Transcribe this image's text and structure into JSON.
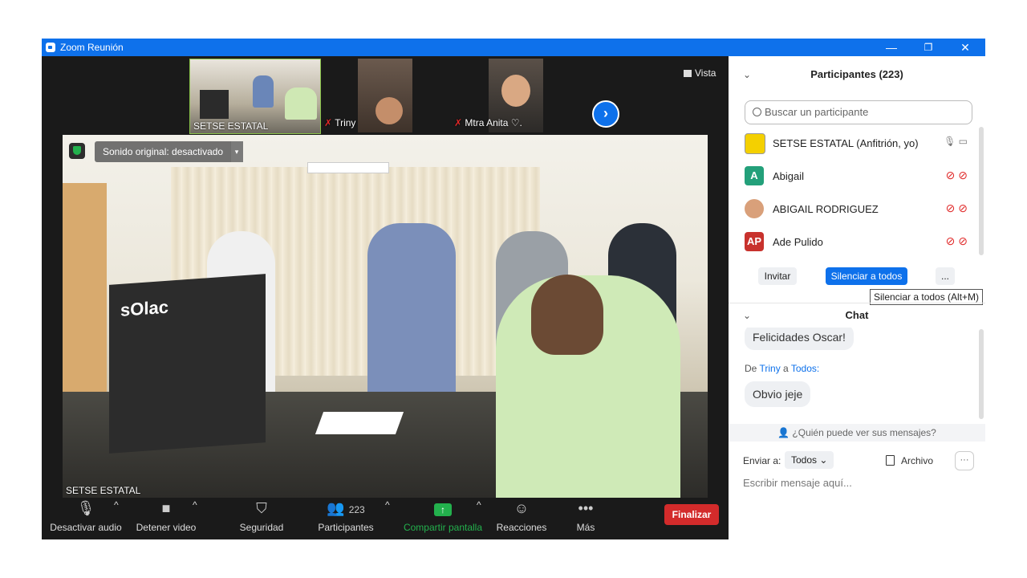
{
  "window": {
    "title": "Zoom Reunión",
    "controls": {
      "minimize": "—",
      "restore": "❐",
      "close": "✕"
    }
  },
  "gallery": {
    "thumbnails": [
      {
        "name": "SETSE ESTATAL",
        "muted": false
      },
      {
        "name": "Triny",
        "muted": true
      },
      {
        "name": "Mtra Anita ♡.",
        "muted": true
      }
    ],
    "next_arrow": "›",
    "view_label": "Vista"
  },
  "main_video": {
    "sound_label": "Sonido original: desactivado",
    "sound_dropdown": "▾",
    "box_brand": "sOlac",
    "speaker_name": "SETSE ESTATAL"
  },
  "toolbar": {
    "audio": "Desactivar audio",
    "video": "Detener video",
    "security": "Seguridad",
    "participants": "Participantes",
    "participants_count": "223",
    "share": "Compartir pantalla",
    "reactions": "Reacciones",
    "more": "Más",
    "end": "Finalizar",
    "caret": "^",
    "more_dots": "•••"
  },
  "participants_panel": {
    "title": "Participantes (223)",
    "collapse": "⌄",
    "search_placeholder": "Buscar un participante",
    "list": [
      {
        "name": "SETSE ESTATAL (Anfitrión, yo)",
        "avatar": "",
        "avatar_color": "#f4d000",
        "status": "host"
      },
      {
        "name": "Abigail",
        "avatar": "A",
        "avatar_color": "#23a07a",
        "status": "muted"
      },
      {
        "name": "ABIGAIL RODRIGUEZ",
        "avatar": "",
        "avatar_color": "#d9a07a",
        "status": "muted"
      },
      {
        "name": "Ade Pulido",
        "avatar": "AP",
        "avatar_color": "#c8322d",
        "status": "muted"
      }
    ],
    "invite": "Invitar",
    "mute_all": "Silenciar a todos",
    "more": "...",
    "tooltip": "Silenciar a todos (Alt+M)"
  },
  "chat": {
    "title": "Chat",
    "collapse": "⌄",
    "message1": "Felicidades Oscar!",
    "from_prefix": "De",
    "from_user": "Triny",
    "from_mid": "a",
    "from_target": "Todos:",
    "message2": "Obvio jeje",
    "who_can_see": "¿Quién puede ver sus mensajes?",
    "send_to_label": "Enviar a:",
    "send_to_value": "Todos",
    "file": "Archivo",
    "more": "···",
    "compose_placeholder": "Escribir mensaje aquí..."
  }
}
